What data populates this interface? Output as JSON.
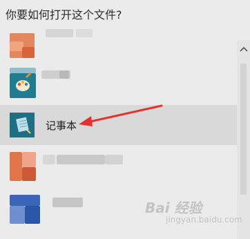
{
  "dialog": {
    "title": "你要如何打开这个文件?"
  },
  "apps": [
    {
      "label": "",
      "icon": "blurred-app-icon",
      "state": "obscured"
    },
    {
      "label": "",
      "icon": "paint-palette-icon",
      "state": "obscured"
    },
    {
      "label": "记事本",
      "icon": "notepad-icon",
      "state": "selected"
    },
    {
      "label": "",
      "icon": "blurred-app-icon",
      "state": "obscured"
    },
    {
      "label": "",
      "icon": "blurred-app-icon",
      "state": "obscured"
    }
  ],
  "annotation": {
    "icon": "red-arrow-icon",
    "color": "#e8312f"
  },
  "watermark": {
    "text": "Bai 经验",
    "sub": "jingyan.baidu.com"
  },
  "colors": {
    "background": "#ebebeb",
    "selected_row": "#d9d9d9",
    "notepad_icon_bg": "#1f6f84"
  }
}
